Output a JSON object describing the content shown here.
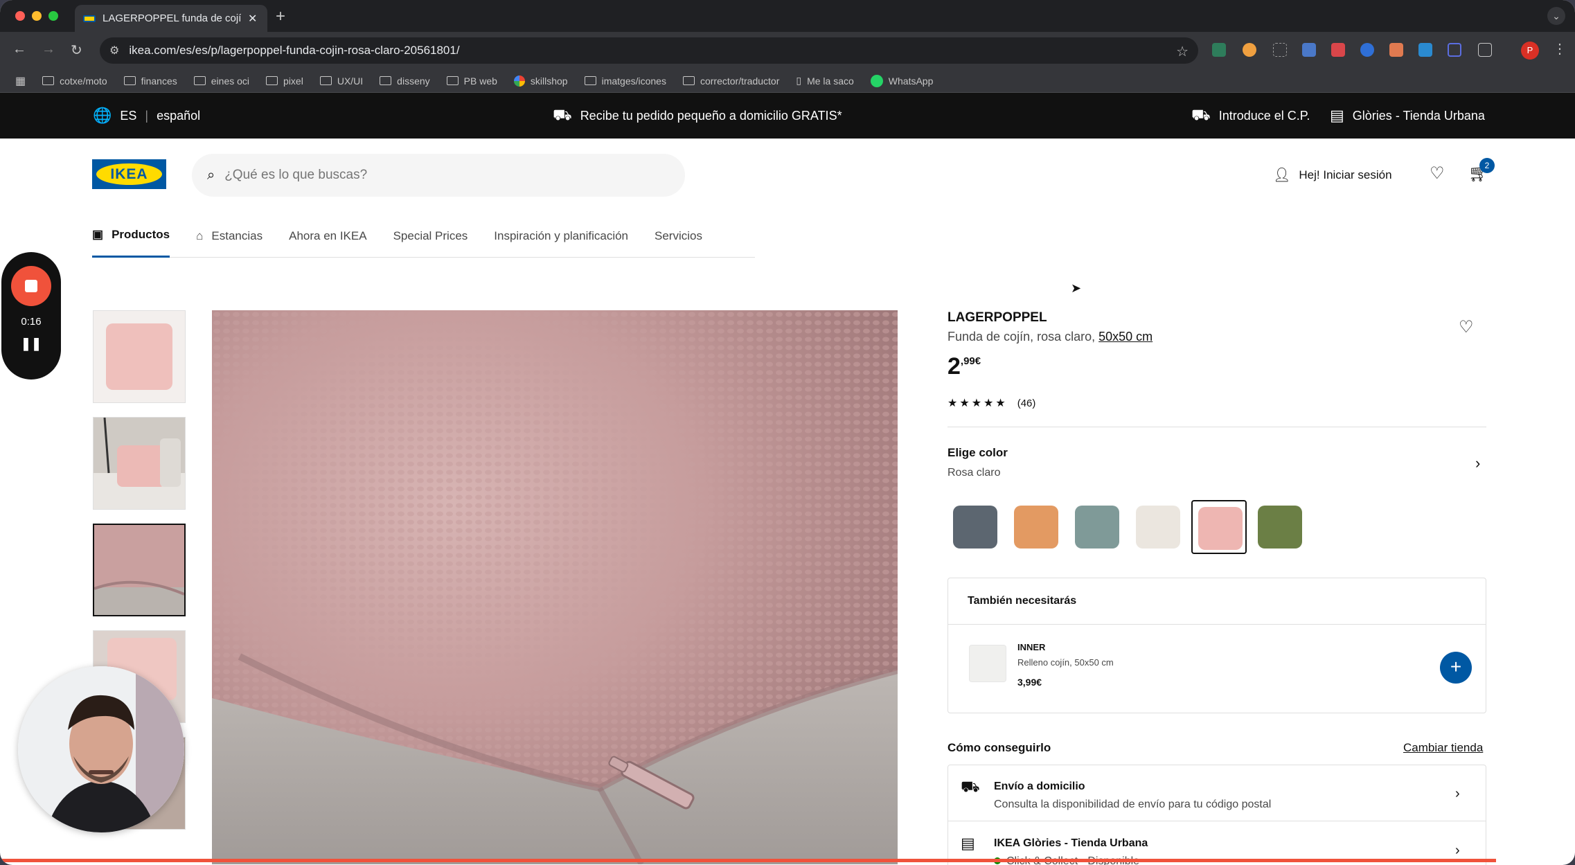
{
  "browser": {
    "tab_title": "LAGERPOPPEL funda de cojín",
    "tab_close": "✕",
    "new_tab": "+",
    "url": "ikea.com/es/es/p/lagerpoppel-funda-cojin-rosa-claro-20561801/",
    "profile_initial": "P",
    "bookmarks": [
      "cotxe/moto",
      "finances",
      "eines oci",
      "pixel",
      "UX/UI",
      "disseny",
      "PB web",
      "skillshop",
      "imatges/icones",
      "corrector/traductor",
      "Me la saco",
      "WhatsApp"
    ]
  },
  "topbar": {
    "lang_code": "ES",
    "lang_name": "español",
    "promo": "Recibe tu pedido pequeño a domicilio GRATIS*",
    "postcode": "Introduce el C.P.",
    "store": "Glòries - Tienda Urbana"
  },
  "header": {
    "logo_text": "IKEA",
    "search_placeholder": "¿Qué es lo que buscas?",
    "login": "Hej! Iniciar sesión",
    "cart_count": "2"
  },
  "nav": {
    "items": [
      "Productos",
      "Estancias",
      "Ahora en IKEA",
      "Special Prices",
      "Inspiración y planificación",
      "Servicios"
    ]
  },
  "recorder": {
    "time": "0:16",
    "pause_symbol": "❚❚"
  },
  "product": {
    "name": "LAGERPOPPEL",
    "desc": "Funda de cojín, rosa claro,",
    "size": "50x50 cm",
    "price_int": "2",
    "price_dec": ",99€",
    "stars": "★★★★★",
    "rating_value": 4.5,
    "review_count": "(46)",
    "color_label": "Elige color",
    "color_value": "Rosa claro",
    "swatches": [
      {
        "name": "Gris oscuro",
        "color": "#5c6670"
      },
      {
        "name": "Naranja",
        "color": "#e39a62"
      },
      {
        "name": "Gris verde",
        "color": "#7f9a98"
      },
      {
        "name": "Blanco",
        "color": "#ebe6df"
      },
      {
        "name": "Rosa claro",
        "color": "#eeb6b2",
        "selected": true
      },
      {
        "name": "Verde",
        "color": "#6b7f45"
      }
    ]
  },
  "also_need": {
    "title": "También necesitarás",
    "item_name": "INNER",
    "item_desc": "Relleno cojín, 50x50 cm",
    "item_price": "3,99€",
    "add_symbol": "+"
  },
  "how_to_get": {
    "title": "Cómo conseguirlo",
    "change_store": "Cambiar tienda",
    "delivery_title": "Envío a domicilio",
    "delivery_desc": "Consulta la disponibilidad de envío para tu código postal",
    "store_title": "IKEA Glòries - Tienda Urbana",
    "store_status": "Click & Collect - Disponible"
  },
  "colors": {
    "ikea_blue": "#0058a3",
    "ikea_yellow": "#ffdb00",
    "record_red": "#f0523b"
  }
}
